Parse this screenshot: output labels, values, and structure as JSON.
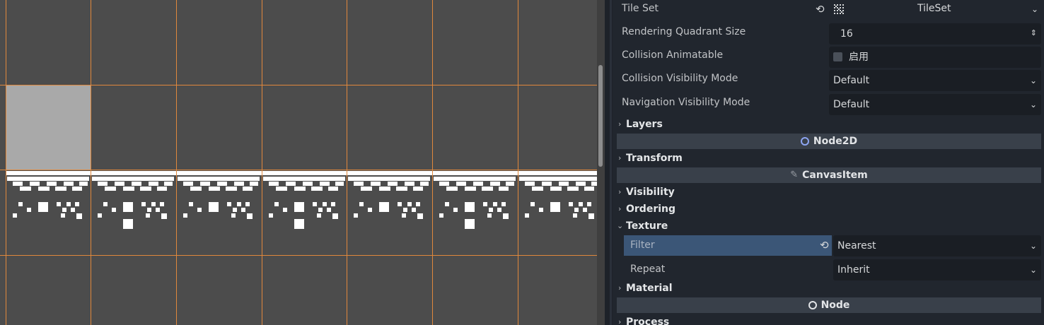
{
  "viewport": {
    "label": "TileMap editor viewport"
  },
  "inspector": {
    "tile_set": {
      "label": "Tile Set",
      "value": "TileSet",
      "revert_icon": "revert-icon",
      "resource_icon": "tileset-resource-icon"
    },
    "rendering_quadrant_size": {
      "label": "Rendering Quadrant Size",
      "value": "16"
    },
    "collision_animatable": {
      "label": "Collision Animatable",
      "checkbox_text": "启用",
      "checked": false
    },
    "collision_visibility_mode": {
      "label": "Collision Visibility Mode",
      "value": "Default"
    },
    "navigation_visibility_mode": {
      "label": "Navigation Visibility Mode",
      "value": "Default"
    },
    "layers_section": "Layers",
    "node2d_header": "Node2D",
    "transform_section": "Transform",
    "canvasitem_header": "CanvasItem",
    "visibility_section": "Visibility",
    "ordering_section": "Ordering",
    "texture_section": "Texture",
    "filter": {
      "label": "Filter",
      "value": "Nearest"
    },
    "repeat": {
      "label": "Repeat",
      "value": "Inherit"
    },
    "material_section": "Material",
    "node_header": "Node",
    "process_section": "Process",
    "colors": {
      "node2d_icon": "#8da5f3",
      "highlight": "#3b5677",
      "grid_line": "#e0883c"
    }
  }
}
